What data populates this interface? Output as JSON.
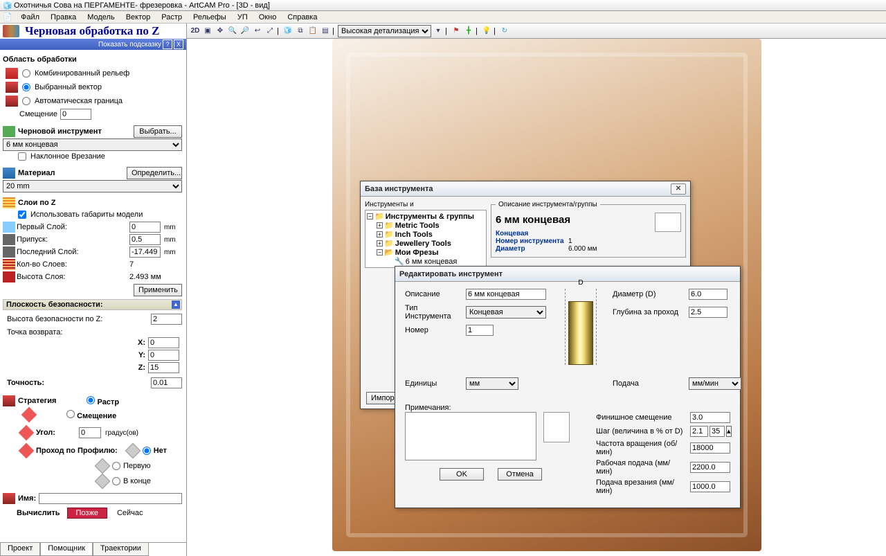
{
  "window": {
    "title": "Охотничья Сова на ПЕРГАМЕНТЕ- фрезеровка - ArtCAM Pro - [3D - вид]"
  },
  "menu": [
    "Файл",
    "Правка",
    "Модель",
    "Вектор",
    "Растр",
    "Рельефы",
    "УП",
    "Окно",
    "Справка"
  ],
  "panel": {
    "title": "Черновая обработка по Z",
    "hint": "Показать подсказку",
    "area_label": "Область обработки",
    "opt_combined": "Комбинированный рельеф",
    "opt_vector": "Выбранный вектор",
    "opt_auto": "Автоматическая граница",
    "offset_label": "Смещение",
    "offset_val": "0",
    "rough_tool_label": "Черновой инструмент",
    "select_btn": "Выбрать...",
    "tool_sel": "6 мм концевая",
    "ramp_label": "Наклонное Врезание",
    "material_label": "Материал",
    "define_btn": "Определить...",
    "material_sel": "20 mm",
    "zlayers_label": "Слои по Z",
    "use_model_bounds": "Использовать габариты модели",
    "first_layer": "Первый Слой:",
    "first_val": "0",
    "allowance": "Припуск:",
    "allowance_val": "0.5",
    "last_layer": "Последний Слой:",
    "last_val": "-17.449",
    "layer_count": "Кол-во Слоев:",
    "layer_count_val": "7",
    "layer_h": "Высота Слоя:",
    "layer_h_val": "2.493 мм",
    "apply": "Применить",
    "unit_mm": "mm",
    "safety_label": "Плоскость безопасности:",
    "safe_z_label": "Высота безопасности по Z:",
    "safe_z": "2",
    "home_label": "Точка возврата:",
    "hx": "0",
    "hy": "0",
    "hz": "15",
    "tol_label": "Точность:",
    "tol": "0.01",
    "strategy": "Стратегия",
    "raster": "Растр",
    "offset": "Смещение",
    "angle_label": "Угол:",
    "angle": "0",
    "angle_unit": "градус(ов)",
    "profile_label": "Проход по Профилю:",
    "none": "Нет",
    "first": "Первую",
    "last": "В конце",
    "name_label": "Имя:",
    "name_val": "",
    "calc": "Вычислить",
    "later": "Позже",
    "now": "Сейчас"
  },
  "tabs": [
    "Проект",
    "Помощник",
    "Траектории"
  ],
  "vtb": {
    "detail": "Высокая детализация"
  },
  "tooldb": {
    "title": "База инструмента",
    "tree_header": "Инструменты и",
    "root": "Инструменты & группы",
    "items": [
      "Metric Tools",
      "Inch Tools",
      "Jewellery Tools",
      "Мои Фрезы"
    ],
    "leaf": "6 мм концевая",
    "group_label": "Описание инструмента/группы",
    "tool_name": "6 мм концевая",
    "tool_type": "Концевая",
    "num_label": "Номер инструмента",
    "num": "1",
    "diam_label": "Диаметр",
    "diam": "6.000 мм",
    "import": "Импор"
  },
  "edit": {
    "title": "Редактировать инструмент",
    "desc_label": "Описание",
    "desc": "6 мм концевая",
    "type_label": "Тип Инструмента",
    "type": "Концевая",
    "num_label": "Номер",
    "num": "1",
    "units_label": "Единицы",
    "units": "мм",
    "feed_label": "Подача",
    "feed": "мм/мин",
    "diam_label": "Диаметр (D)",
    "diam": "6.0",
    "step_label": "Глубина за проход",
    "step": "2.5",
    "notes_label": "Примечания:",
    "d_marker": "D",
    "finish_offset": "Финишное смещение",
    "finish": "3.0",
    "stepover_label": "Шаг (величина в % от D)",
    "step_mm": "2.1",
    "step_pct": "35",
    "spindle": "Частота вращения (об/мин)",
    "spindle_v": "18000",
    "workfeed": "Рабочая подача (мм/мин)",
    "workfeed_v": "2200.0",
    "plunge": "Подача врезания (мм/мин)",
    "plunge_v": "1000.0",
    "ok": "OK",
    "cancel": "Отмена"
  }
}
